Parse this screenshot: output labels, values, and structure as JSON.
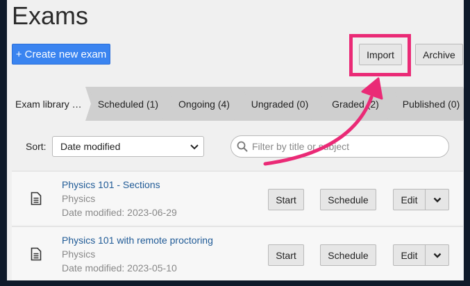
{
  "page": {
    "title": "Exams"
  },
  "toolbar": {
    "create_label": "+ Create new exam",
    "import_label": "Import",
    "archive_label": "Archive"
  },
  "tabs": [
    {
      "label": "Exam library …",
      "active": true
    },
    {
      "label": "Scheduled (1)"
    },
    {
      "label": "Ongoing (4)"
    },
    {
      "label": "Ungraded (0)"
    },
    {
      "label": "Graded (2)"
    },
    {
      "label": "Published (0)"
    }
  ],
  "sort": {
    "label": "Sort:",
    "value": "Date modified"
  },
  "search": {
    "placeholder": "Filter by title or subject"
  },
  "exams": [
    {
      "title": "Physics 101 - Sections",
      "subject": "Physics",
      "date": "Date modified: 2023-06-29",
      "start": "Start",
      "schedule": "Schedule",
      "edit": "Edit"
    },
    {
      "title": "Physics 101 with remote proctoring",
      "subject": "Physics",
      "date": "Date modified: 2023-05-10",
      "start": "Start",
      "schedule": "Schedule",
      "edit": "Edit"
    }
  ],
  "colors": {
    "accent": "#3a84f0",
    "highlight": "#ea2a76",
    "link": "#1f5a96"
  },
  "icons": {
    "row_icon": "document-icon",
    "dropdown": "chevron-down-icon",
    "search": "search-icon"
  }
}
